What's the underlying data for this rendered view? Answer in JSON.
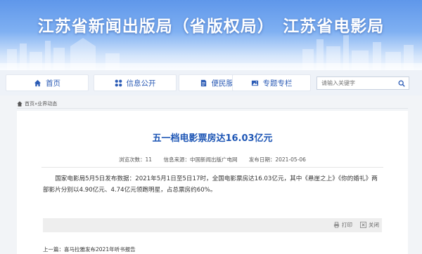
{
  "header": {
    "title": "江苏省新闻出版局（省版权局）　江苏省电影局"
  },
  "nav": {
    "items": [
      {
        "label": "首页",
        "icon": "home-icon"
      },
      {
        "label": "信息公开",
        "icon": "grid-icon"
      },
      {
        "label": "便民服务",
        "icon": "document-icon"
      },
      {
        "label": "专题专栏",
        "icon": "image-icon"
      }
    ],
    "search_placeholder": "请输入关键字"
  },
  "breadcrumb": {
    "home": "首页",
    "separator": " » ",
    "current": "业界动态"
  },
  "article": {
    "title": "五一档电影票房达16.03亿元",
    "views": "浏览次数：11",
    "source": "信息来源：中国新闻出版广电网",
    "date": "发布日期：2021-05-06",
    "body": "国家电影局5月5日发布数据：2021年5月1日至5日17时，全国电影票房达16.03亿元，其中《悬崖之上》《你的婚礼》两部影片分别以4.90亿元、4.74亿元领跑明星，占总票房约60%。"
  },
  "tools": {
    "print": "打印",
    "close": "关闭"
  },
  "pager": {
    "prev": "上一篇：喜马拉雅发布2021年听书报告"
  },
  "colors": {
    "accent": "#1e56b5",
    "banner": "#5f97ea"
  }
}
